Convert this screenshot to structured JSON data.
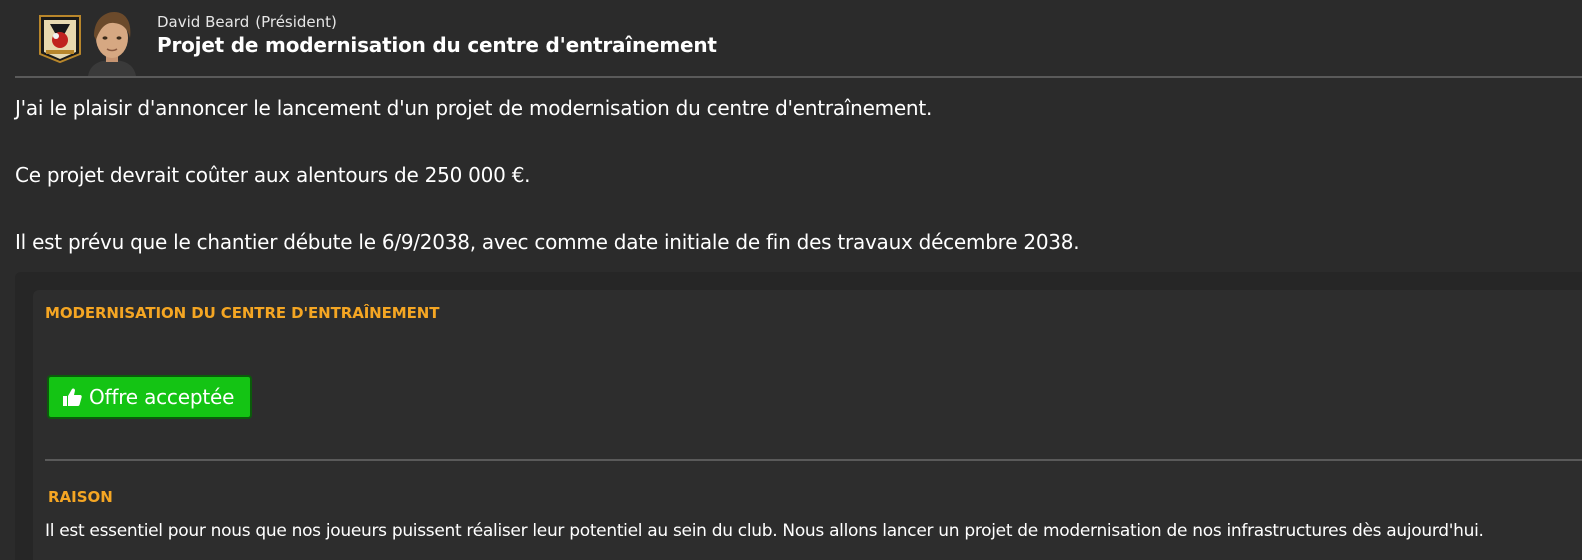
{
  "header": {
    "sender_name": "David Beard",
    "sender_role": "(Président)",
    "subject": "Projet de modernisation du centre d'entraînement",
    "club_badge_icon": "club-crest-icon",
    "avatar_icon": "president-portrait"
  },
  "message": {
    "paragraph_1": "J'ai le plaisir d'annoncer le lancement d'un projet de modernisation du centre d'entraînement.",
    "paragraph_2": "Ce projet devrait coûter aux alentours de 250 000 €.",
    "paragraph_3": "Il est prévu que le chantier débute le 6/9/2038, avec comme date initiale de fin des travaux décembre 2038."
  },
  "panel": {
    "title": "MODERNISATION DU CENTRE D'ENTRAÎNEMENT",
    "status_button_label": "Offre acceptée",
    "status_button_icon": "thumbs-up-icon",
    "reason_heading": "RAISON",
    "reason_text": "Il est essentiel pour nous que nos joueurs puissent réaliser leur potentiel au sein du club. Nous allons lancer un projet de modernisation de nos infrastructures dès aujourd'hui."
  },
  "colors": {
    "background": "#2b2b2b",
    "accent_orange": "#f5a623",
    "accept_green": "#14c414"
  }
}
